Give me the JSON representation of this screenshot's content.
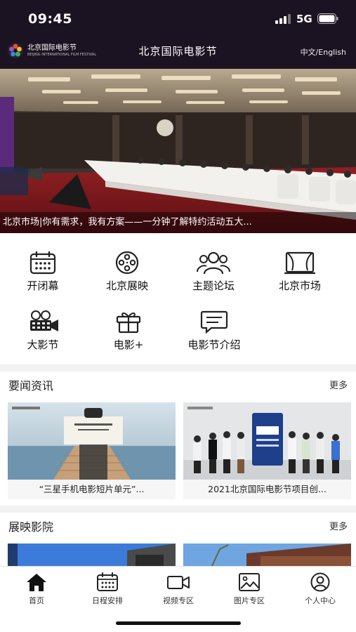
{
  "status_bar": {
    "time": "09:45",
    "network": "5G"
  },
  "header": {
    "logo_cn": "北京国际电影节",
    "logo_en": "BEIJING INTERNATIONAL FILM FESTIVAL",
    "title": "北京国际电影节",
    "lang_switch": "中文/English"
  },
  "banner": {
    "caption": "北京市场|你有需求，我有方案——一分钟了解特约活动五大..."
  },
  "quick_menu": [
    {
      "label": "开闭幕",
      "icon": "calendar-icon"
    },
    {
      "label": "北京展映",
      "icon": "film-reel-icon"
    },
    {
      "label": "主题论坛",
      "icon": "people-group-icon"
    },
    {
      "label": "北京市场",
      "icon": "stage-curtain-icon"
    },
    {
      "label": "大影节",
      "icon": "film-camera-icon"
    },
    {
      "label": "电影+",
      "icon": "gift-icon"
    },
    {
      "label": "电影节介绍",
      "icon": "message-icon"
    }
  ],
  "news_section": {
    "title": "要闻资讯",
    "more": "更多",
    "items": [
      {
        "title": "“三星手机电影短片单元”..."
      },
      {
        "title": "2021北京国际电影节项目创..."
      }
    ]
  },
  "cinema_section": {
    "title": "展映影院",
    "more": "更多"
  },
  "tab_bar": [
    {
      "label": "首页",
      "icon": "home-icon",
      "active": true
    },
    {
      "label": "日程安排",
      "icon": "schedule-calendar-icon",
      "active": false
    },
    {
      "label": "视频专区",
      "icon": "video-camera-icon",
      "active": false
    },
    {
      "label": "图片专区",
      "icon": "picture-icon",
      "active": false
    },
    {
      "label": "个人中心",
      "icon": "user-profile-icon",
      "active": false
    }
  ],
  "colors": {
    "header_bg": "#1c1322",
    "divider": "#f2f2f2"
  }
}
